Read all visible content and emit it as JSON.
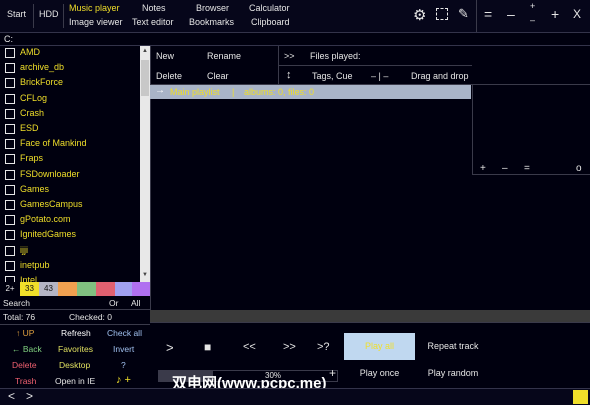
{
  "topbar": {
    "start": "Start",
    "hdd": "HDD",
    "menu": {
      "music_player": "Music player",
      "image_viewer": "Image viewer",
      "notes": "Notes",
      "text_editor": "Text editor",
      "browser": "Browser",
      "bookmarks": "Bookmarks",
      "calculator": "Calculator",
      "clipboard": "Clipboard"
    },
    "window_controls": {
      "equals": "=",
      "minus": "–",
      "plus": "+",
      "close": "X",
      "small_plus": "+",
      "small_minus": "–"
    }
  },
  "path": {
    "value": "C:"
  },
  "folders": [
    "AMD",
    "archive_db",
    "BrickForce",
    "CFLog",
    "Crash",
    "ESD",
    "Face of Mankind",
    "Fraps",
    "FSDownloader",
    "Games",
    "GamesCampus",
    "gPotato.com",
    "IgnitedGames",
    "ijji",
    "inetpub",
    "Intel"
  ],
  "swatches": {
    "first": "2+",
    "second": "33",
    "third": "43"
  },
  "colors": {
    "accent": "#f0df2a",
    "playlist_bg": "#a9b4c8",
    "active_mode": "#c0d8f0"
  },
  "toolbar": {
    "new": "New",
    "rename": "Rename",
    "delete": "Delete",
    "clear": "Clear",
    "next": ">>",
    "files_played": "Files played:",
    "sort_icon": "↕",
    "tags_cue": "Tags, Cue",
    "separator": "– | –",
    "drag_drop": "Drag and drop"
  },
  "playlist": {
    "arrow": "→",
    "name": "Main playlist",
    "divider": "|",
    "stats": "albums: 0,  files: 0"
  },
  "rightpanel": {
    "plus": "+",
    "minus": "–",
    "equals": "=",
    "o": "o"
  },
  "bottom_left": {
    "search": "Search",
    "or": "Or",
    "all": "All",
    "total": "Total: 76",
    "checked": "Checked: 0",
    "up": "↑ UP",
    "refresh": "Refresh",
    "check_all": "Check all",
    "back": "← Back",
    "favorites": "Favorites",
    "invert": "Invert",
    "delete": "Delete",
    "desktop": "Desktop",
    "help": "?",
    "trash": "Trash",
    "open_ie": "Open in IE",
    "note": "♪ +"
  },
  "player": {
    "play": ">",
    "stop": "■",
    "prev": "<<",
    "next": ">>",
    "random": ">?",
    "volume": "30%",
    "vol_plus": "+",
    "play_all": "Play all",
    "repeat_track": "Repeat track",
    "play_once": "Play once",
    "play_random": "Play random"
  },
  "statusbar": {
    "back": "<",
    "forward": ">"
  },
  "watermark": "双电网(www.pcpc.me)"
}
